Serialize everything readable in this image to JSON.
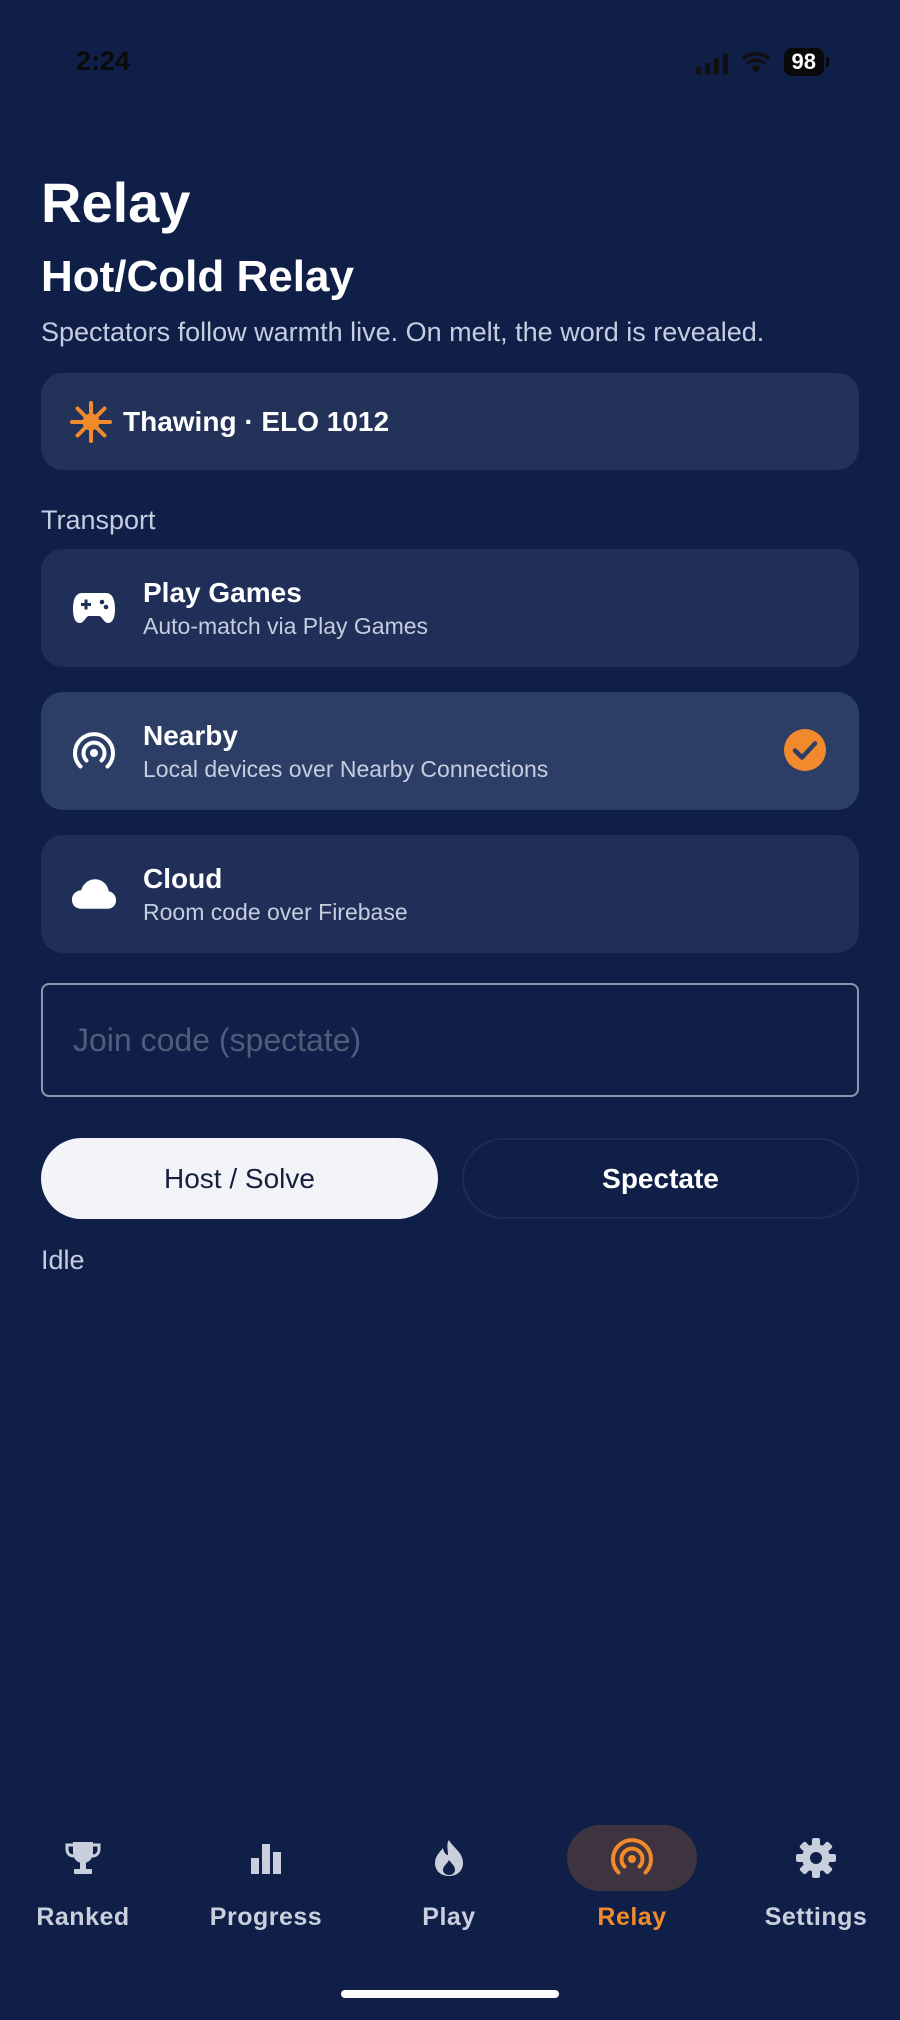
{
  "status_bar": {
    "time": "2:24",
    "battery": "98"
  },
  "header": {
    "app_title": "Relay",
    "section_title": "Hot/Cold Relay",
    "subtitle": "Spectators follow warmth live. On melt, the word is revealed."
  },
  "rank": {
    "text": "Thawing · ELO 1012",
    "icon": "snowflake-sun-icon",
    "accent": "#f08a2c"
  },
  "transport": {
    "label": "Transport",
    "options": [
      {
        "name": "Play Games",
        "description": "Auto-match via Play Games",
        "icon": "gamepad-icon",
        "selected": false
      },
      {
        "name": "Nearby",
        "description": "Local devices over Nearby Connections",
        "icon": "nearby-icon",
        "selected": true
      },
      {
        "name": "Cloud",
        "description": "Room code over Firebase",
        "icon": "cloud-icon",
        "selected": false
      }
    ]
  },
  "join": {
    "placeholder": "Join code (spectate)",
    "value": ""
  },
  "actions": {
    "host_label": "Host / Solve",
    "spectate_label": "Spectate"
  },
  "status": {
    "text": "Idle"
  },
  "nav": {
    "items": [
      {
        "label": "Ranked",
        "icon": "trophy-icon",
        "active": false
      },
      {
        "label": "Progress",
        "icon": "bar-chart-icon",
        "active": false
      },
      {
        "label": "Play",
        "icon": "flame-icon",
        "active": false
      },
      {
        "label": "Relay",
        "icon": "broadcast-icon",
        "active": true
      },
      {
        "label": "Settings",
        "icon": "gear-icon",
        "active": false
      }
    ]
  },
  "colors": {
    "background": "#0f1f47",
    "card": "#1f2f57",
    "accent": "#f08a2c"
  }
}
